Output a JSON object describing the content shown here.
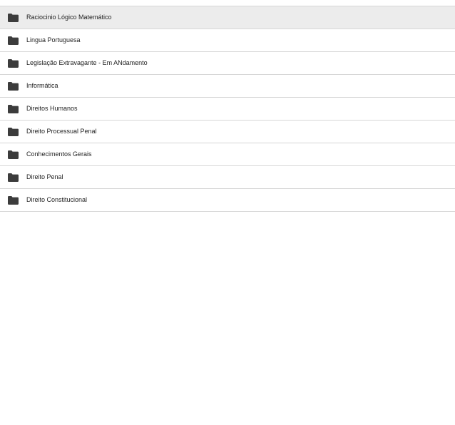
{
  "folders": [
    {
      "label": "Raciocinio Lógico Matemático",
      "icon": "folder-icon",
      "selected": true
    },
    {
      "label": "Lingua Portuguesa",
      "icon": "folder-icon",
      "selected": false
    },
    {
      "label": "Legislação Extravagante - Em ANdamento",
      "icon": "folder-icon",
      "selected": false
    },
    {
      "label": "Informática",
      "icon": "folder-icon",
      "selected": false
    },
    {
      "label": "Direitos Humanos",
      "icon": "folder-icon",
      "selected": false
    },
    {
      "label": "Direito Processual Penal",
      "icon": "folder-icon",
      "selected": false
    },
    {
      "label": "Conhecimentos Gerais",
      "icon": "folder-icon",
      "selected": false
    },
    {
      "label": "Direito Penal",
      "icon": "folder-icon",
      "selected": false
    },
    {
      "label": "Direito Constitucional",
      "icon": "folder-icon",
      "selected": false
    }
  ],
  "colors": {
    "selected_background": "#ececec",
    "divider": "#d6d6d6",
    "icon": "#3c3c3c",
    "text": "#222222"
  }
}
